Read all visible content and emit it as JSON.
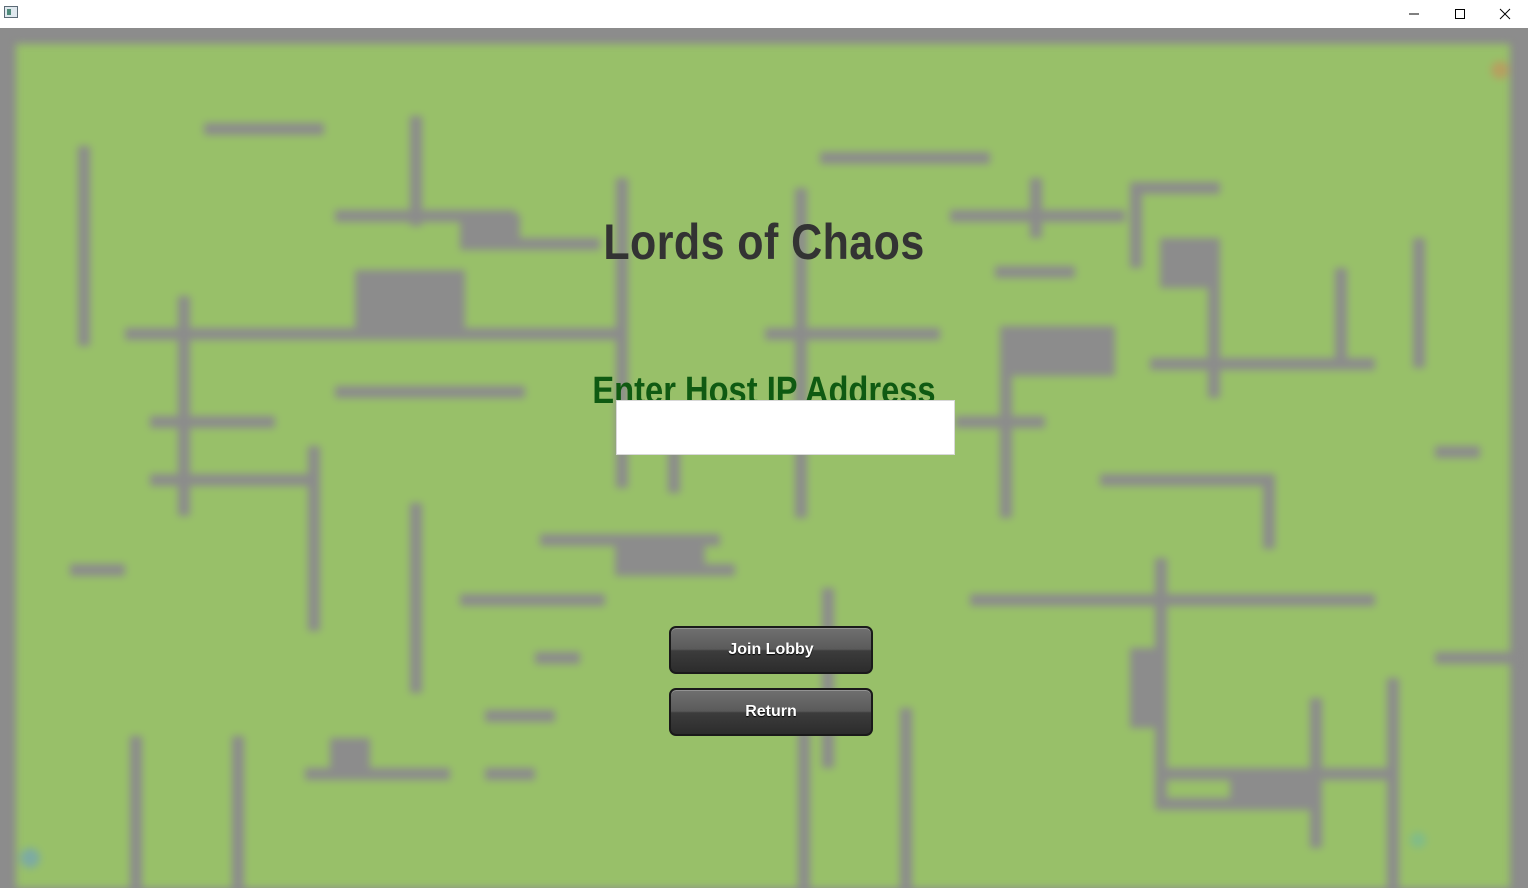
{
  "window": {
    "icon": "app-window-icon",
    "controls": [
      "minimize-icon",
      "maximize-icon",
      "close-icon"
    ]
  },
  "game": {
    "title": "Lords of Chaos",
    "prompt": "Enter Host IP Address",
    "ip_input": {
      "value": "",
      "placeholder": ""
    },
    "buttons": {
      "join": "Join Lobby",
      "return": "Return"
    }
  },
  "colors": {
    "field": "#98c069",
    "walls": "#8c8c8c",
    "title": "#333333",
    "prompt": "#0f5a12",
    "button": "#3c3c3c"
  }
}
